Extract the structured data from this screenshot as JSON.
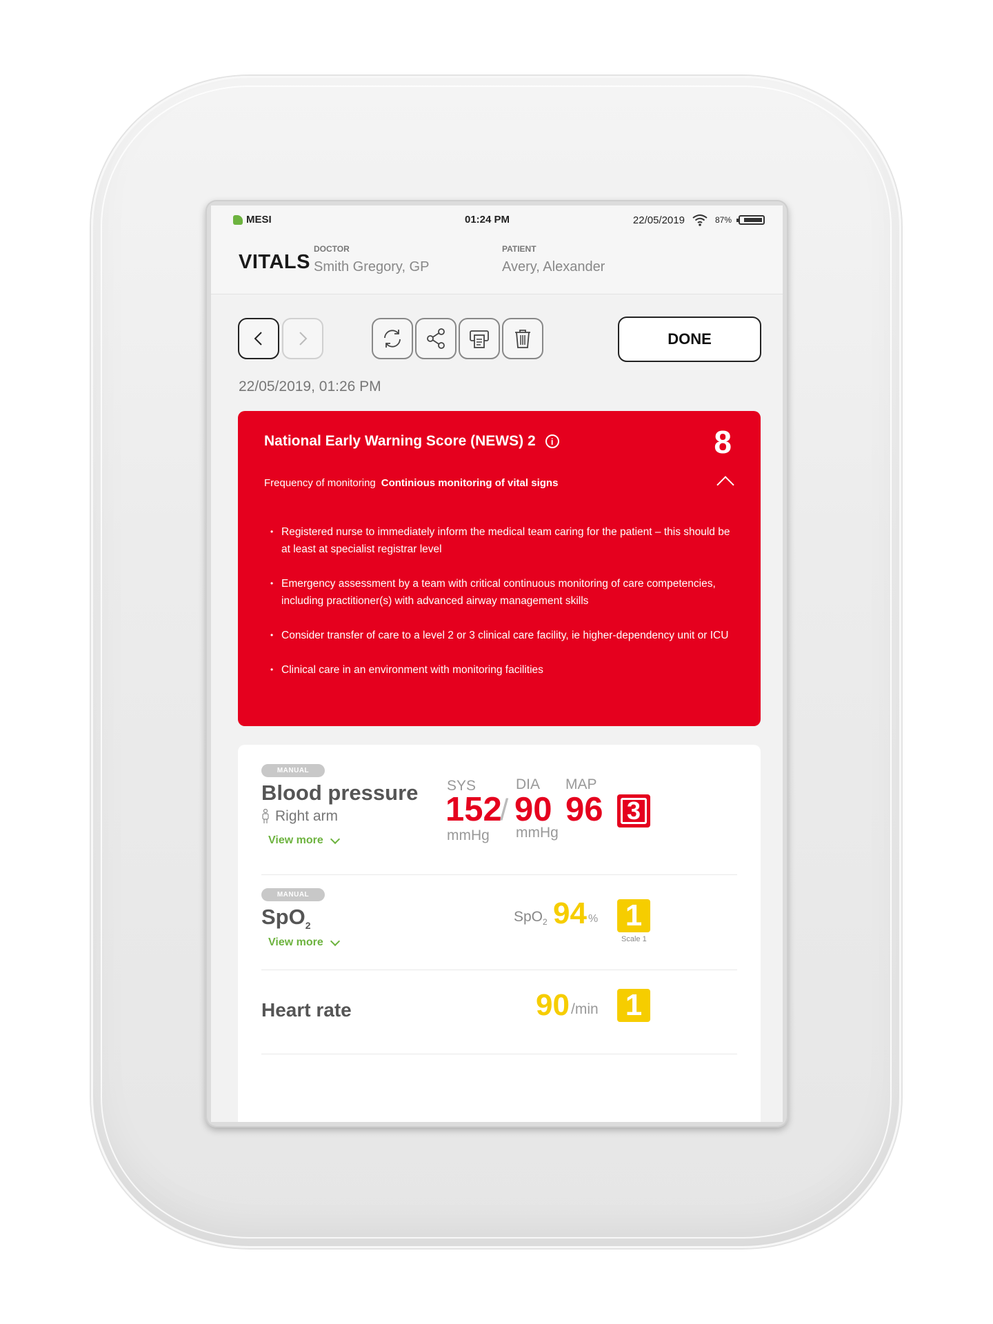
{
  "statusbar": {
    "brand": "MESI",
    "time": "01:24 PM",
    "date": "22/05/2019",
    "battery": "87%",
    "battery_level": 0.87
  },
  "header": {
    "title": "VITALS",
    "doctor_label": "DOCTOR",
    "doctor_name": "Smith Gregory, GP",
    "patient_label": "PATIENT",
    "patient_name": "Avery, Alexander"
  },
  "toolbar": {
    "icons": [
      "back-icon",
      "forward-icon",
      "refresh-icon",
      "share-icon",
      "print-icon",
      "trash-icon"
    ],
    "done_label": "DONE"
  },
  "record_datetime": "22/05/2019, 01:26 PM",
  "news": {
    "title": "National Early Warning Score (NEWS) 2",
    "score": "8",
    "frequency_label": "Frequency of monitoring",
    "frequency_value": "Continious monitoring of vital signs",
    "recommendations": [
      "Registered nurse to immediately inform the medical team caring for the patient – this should be at least at specialist registrar level",
      "Emergency assessment by a team with critical continuous monitoring of care competencies, including practitioner(s)  with advanced airway management skills",
      "Consider transfer of care to a level 2 or 3 clinical care facility, ie higher-dependency unit or ICU",
      "Clinical care in an environment with monitoring facilities"
    ],
    "color": "#e5001e"
  },
  "vitals": {
    "blood_pressure": {
      "badge": "MANUAL",
      "title": "Blood pressure",
      "location": "Right arm",
      "view_more": "View more",
      "sys_label": "SYS",
      "dia_label": "DIA",
      "map_label": "MAP",
      "sys": "152",
      "slash": "/",
      "dia": "90",
      "map": "96",
      "sys_unit": "mmHg",
      "dia_unit": "mmHg",
      "score": "3"
    },
    "spo2": {
      "badge": "MANUAL",
      "title": "SpO",
      "title_sub": "2",
      "view_more": "View more",
      "label": "SpO",
      "label_sub": "2",
      "value": "94",
      "unit": "%",
      "score": "1",
      "scale": "Scale 1"
    },
    "heart_rate": {
      "title": "Heart rate",
      "value": "90",
      "unit": "/min",
      "score": "1"
    }
  },
  "colors": {
    "alert_red": "#e5001e",
    "warning_yellow": "#f6cd00",
    "accent_green": "#6db33f"
  }
}
